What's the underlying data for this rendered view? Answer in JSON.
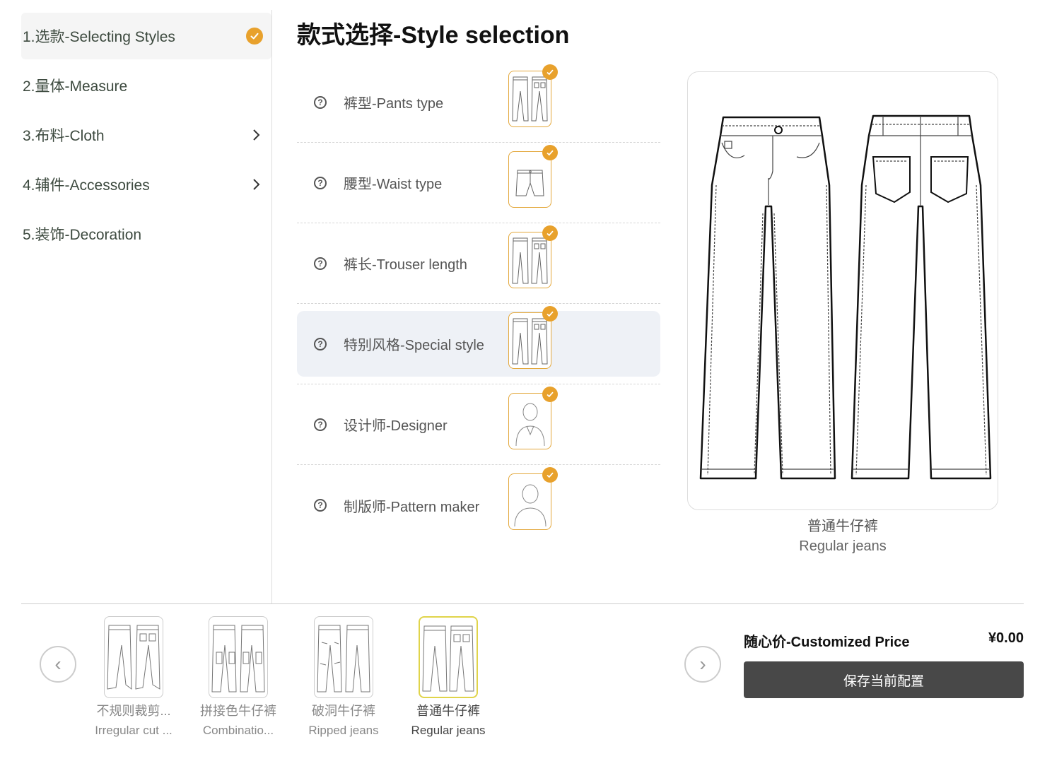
{
  "sidebar": {
    "items": [
      {
        "label": "1.选款-Selecting Styles",
        "icon": "check-circle-icon"
      },
      {
        "label": "2.量体-Measure"
      },
      {
        "label": "3.布料-Cloth",
        "icon": "chevron-right-icon"
      },
      {
        "label": "4.辅件-Accessories",
        "icon": "chevron-right-icon"
      },
      {
        "label": "5.装饰-Decoration"
      }
    ]
  },
  "main": {
    "title": "款式选择-Style selection",
    "options": [
      {
        "label": "裤型-Pants type"
      },
      {
        "label": "腰型-Waist type"
      },
      {
        "label": "裤长-Trouser length"
      },
      {
        "label": "特别风格-Special style"
      },
      {
        "label": "设计师-Designer"
      },
      {
        "label": "制版师-Pattern maker"
      }
    ],
    "help_glyph": "?"
  },
  "preview": {
    "name_cn": "普通牛仔裤",
    "name_en": "Regular jeans"
  },
  "carousel": {
    "prev_glyph": "‹",
    "next_glyph": "›",
    "items": [
      {
        "cn": "不规则裁剪...",
        "en": "Irregular cut ..."
      },
      {
        "cn": "拼接色牛仔裤",
        "en": "Combinatio..."
      },
      {
        "cn": "破洞牛仔裤",
        "en": "Ripped jeans"
      },
      {
        "cn": "普通牛仔裤",
        "en": "Regular jeans"
      }
    ]
  },
  "price": {
    "label": "随心价-Customized Price",
    "value": "¥0.00"
  },
  "save_button": "保存当前配置",
  "colors": {
    "accent": "#e8a12c",
    "selected_border": "#e0d44a",
    "button_bg": "#484848",
    "highlight_bg": "#eef1f6"
  }
}
